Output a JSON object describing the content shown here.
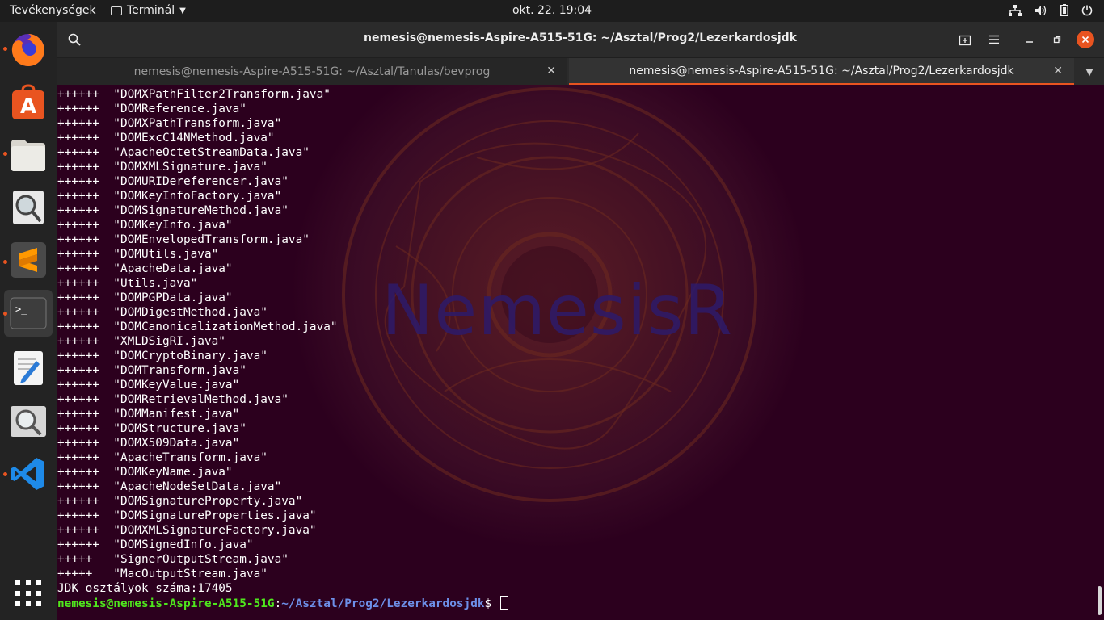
{
  "topbar": {
    "activities": "Tevékenységek",
    "app_menu": "Terminál",
    "clock": "okt. 22.  19:04",
    "icons": [
      "network-icon",
      "volume-icon",
      "battery-icon",
      "power-menu-icon"
    ]
  },
  "dock": {
    "items": [
      {
        "name": "firefox",
        "running": true
      },
      {
        "name": "ubuntu-software",
        "running": false
      },
      {
        "name": "files",
        "running": true
      },
      {
        "name": "image-viewer",
        "running": false
      },
      {
        "name": "sublime-text",
        "running": true
      },
      {
        "name": "terminal",
        "running": true,
        "active": true
      },
      {
        "name": "text-editor",
        "running": false
      },
      {
        "name": "image-viewer-2",
        "running": false
      },
      {
        "name": "vscode",
        "running": true
      },
      {
        "name": "show-applications",
        "running": false
      }
    ]
  },
  "window": {
    "title": "nemesis@nemesis-Aspire-A515-51G: ~/Asztal/Prog2/Lezerkardosjdk",
    "tabs": [
      {
        "label": "nemesis@nemesis-Aspire-A515-51G: ~/Asztal/Tanulas/bevprog",
        "active": false
      },
      {
        "label": "nemesis@nemesis-Aspire-A515-51G: ~/Asztal/Prog2/Lezerkardosjdk",
        "active": true
      }
    ]
  },
  "wallpaper": {
    "text": "NemesisR"
  },
  "terminal": {
    "lines": [
      "++++++  \"DOMXPathFilter2Transform.java\"",
      "++++++  \"DOMReference.java\"",
      "++++++  \"DOMXPathTransform.java\"",
      "++++++  \"DOMExcC14NMethod.java\"",
      "++++++  \"ApacheOctetStreamData.java\"",
      "++++++  \"DOMXMLSignature.java\"",
      "++++++  \"DOMURIDereferencer.java\"",
      "++++++  \"DOMKeyInfoFactory.java\"",
      "++++++  \"DOMSignatureMethod.java\"",
      "++++++  \"DOMKeyInfo.java\"",
      "++++++  \"DOMEnvelopedTransform.java\"",
      "++++++  \"DOMUtils.java\"",
      "++++++  \"ApacheData.java\"",
      "++++++  \"Utils.java\"",
      "++++++  \"DOMPGPData.java\"",
      "++++++  \"DOMDigestMethod.java\"",
      "++++++  \"DOMCanonicalizationMethod.java\"",
      "++++++  \"XMLDSigRI.java\"",
      "++++++  \"DOMCryptoBinary.java\"",
      "++++++  \"DOMTransform.java\"",
      "++++++  \"DOMKeyValue.java\"",
      "++++++  \"DOMRetrievalMethod.java\"",
      "++++++  \"DOMManifest.java\"",
      "++++++  \"DOMStructure.java\"",
      "++++++  \"DOMX509Data.java\"",
      "++++++  \"ApacheTransform.java\"",
      "++++++  \"DOMKeyName.java\"",
      "++++++  \"ApacheNodeSetData.java\"",
      "++++++  \"DOMSignatureProperty.java\"",
      "++++++  \"DOMSignatureProperties.java\"",
      "++++++  \"DOMXMLSignatureFactory.java\"",
      "++++++  \"DOMSignedInfo.java\"",
      "+++++   \"SignerOutputStream.java\"",
      "+++++   \"MacOutputStream.java\"",
      "JDK osztályok száma:17405"
    ],
    "prompt": {
      "user_host": "nemesis@nemesis-Aspire-A515-51G",
      "separator": ":",
      "path": "~/Asztal/Prog2/Lezerkardosjdk",
      "symbol": "$ "
    }
  },
  "colors": {
    "accent": "#e95420",
    "terminal_bg": "#2c001e",
    "prompt_user": "#4fe61d",
    "prompt_path": "#6d8fe8"
  }
}
